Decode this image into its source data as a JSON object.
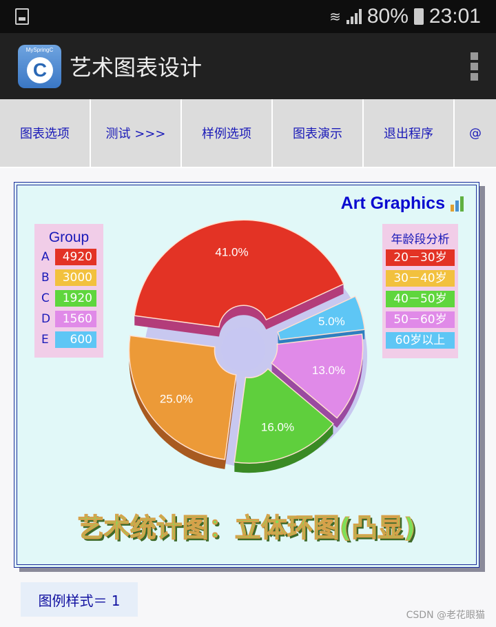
{
  "status_bar": {
    "battery": "80%",
    "time": "23:01"
  },
  "app": {
    "title": "艺术图表设计",
    "logo_text": "MySpringC",
    "logo_letter": "C"
  },
  "toolbar": [
    "图表选项",
    "测试  >>>",
    "样例选项",
    "图表演示",
    "退出程序",
    "@"
  ],
  "chart_header": "Art Graphics",
  "legend_group": {
    "title": "Group",
    "items": [
      {
        "key": "A",
        "value": "4920"
      },
      {
        "key": "B",
        "value": "3000"
      },
      {
        "key": "C",
        "value": "1920"
      },
      {
        "key": "D",
        "value": "1560"
      },
      {
        "key": "E",
        "value": "600"
      }
    ]
  },
  "legend_age": {
    "title": "年龄段分析",
    "items": [
      "20－30岁",
      "30－40岁",
      "40－50岁",
      "50－60岁",
      "60岁以上"
    ]
  },
  "colors": [
    "#e33325",
    "#f2c13e",
    "#5fd63d",
    "#e08ae8",
    "#5ec6f5"
  ],
  "chart_data": {
    "type": "pie",
    "variant": "3d-exploded-donut",
    "categories": [
      "A",
      "B",
      "C",
      "D",
      "E"
    ],
    "values": [
      4920,
      3000,
      1920,
      1560,
      600
    ],
    "labels": [
      "41.0%",
      "25.0%",
      "16.0%",
      "13.0%",
      "5.0%"
    ],
    "slice_colors": [
      "#e33325",
      "#ec9a38",
      "#5fcf3d",
      "#e08ae8",
      "#5ec6f5"
    ],
    "side_colors": [
      "#b33c7a",
      "#a85a20",
      "#3a8a25",
      "#9a4aa0",
      "#2f7fc0"
    ]
  },
  "big_title": "艺术统计图：立体环图(凸显)",
  "footer_button": "图例样式＝ 1",
  "watermark": "CSDN @老花眼猫"
}
